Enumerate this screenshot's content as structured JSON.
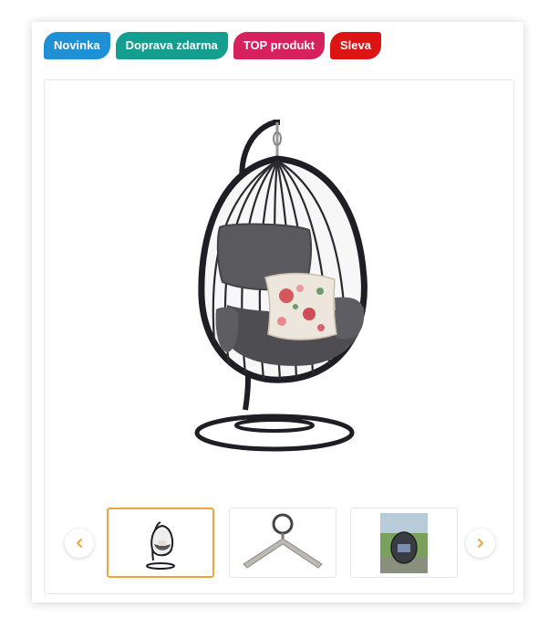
{
  "badges": [
    {
      "label": "Novinka",
      "color": "#1e90d6"
    },
    {
      "label": "Doprava zdarma",
      "color": "#149e8f"
    },
    {
      "label": "TOP produkt",
      "color": "#d6215e"
    },
    {
      "label": "Sleva",
      "color": "#dc1414"
    }
  ],
  "gallery": {
    "main_image": "hanging-egg-chair-image",
    "prev_icon": "chevron-left-icon",
    "next_icon": "chevron-right-icon",
    "accent_color": "#f0a43c",
    "thumbnails": [
      {
        "image": "egg-chair-thumbnail",
        "active": true
      },
      {
        "image": "hanging-hook-thumbnail",
        "active": false
      },
      {
        "image": "garden-chair-thumbnail",
        "active": false
      }
    ]
  }
}
